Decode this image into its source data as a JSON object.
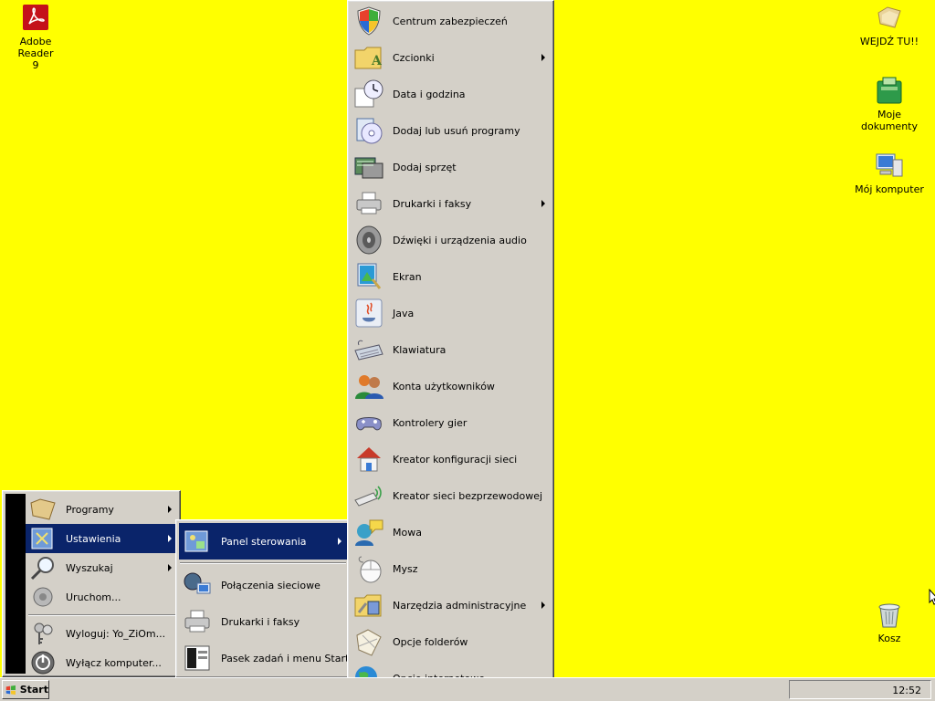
{
  "desktop": {
    "icons": [
      {
        "label": "Adobe Reader\n9",
        "icon": "adobe-reader-icon"
      },
      {
        "label": "WEJDŹ TU!!",
        "icon": "folder-icon"
      },
      {
        "label": "Moje\ndokumenty",
        "icon": "my-documents-icon"
      },
      {
        "label": "Mój komputer",
        "icon": "my-computer-icon"
      },
      {
        "label": "Kosz",
        "icon": "recycle-bin-icon"
      }
    ]
  },
  "start_menu": {
    "items": [
      {
        "label": "Programy",
        "icon": "programs-icon"
      },
      {
        "label": "Ustawienia",
        "icon": "settings-icon"
      },
      {
        "label": "Wyszukaj",
        "icon": "search-icon"
      },
      {
        "label": "Uruchom...",
        "icon": "run-icon"
      },
      {
        "label": "Wyloguj: Yo_ZiOm...",
        "icon": "logoff-icon"
      },
      {
        "label": "Wyłącz komputer...",
        "icon": "shutdown-icon"
      }
    ]
  },
  "settings_menu": {
    "items": [
      {
        "label": "Panel sterowania",
        "icon": "control-panel-icon"
      },
      {
        "label": "Połączenia sieciowe",
        "icon": "network-connections-icon"
      },
      {
        "label": "Drukarki i faksy",
        "icon": "printer-icon"
      },
      {
        "label": "Pasek zadań i menu Start",
        "icon": "taskbar-icon"
      }
    ]
  },
  "control_panel_menu": {
    "items": [
      {
        "label": "Centrum zabezpieczeń",
        "icon": "shield-icon"
      },
      {
        "label": "Czcionki",
        "icon": "fonts-folder-icon"
      },
      {
        "label": "Data i godzina",
        "icon": "clock-icon"
      },
      {
        "label": "Dodaj lub usuń programy",
        "icon": "add-remove-programs-icon"
      },
      {
        "label": "Dodaj sprzęt",
        "icon": "add-hardware-icon"
      },
      {
        "label": "Drukarki i faksy",
        "icon": "printer-icon"
      },
      {
        "label": "Dźwięki i urządzenia audio",
        "icon": "speaker-icon"
      },
      {
        "label": "Ekran",
        "icon": "display-icon"
      },
      {
        "label": "Java",
        "icon": "java-icon"
      },
      {
        "label": "Klawiatura",
        "icon": "keyboard-icon"
      },
      {
        "label": "Konta użytkowników",
        "icon": "user-accounts-icon"
      },
      {
        "label": "Kontrolery gier",
        "icon": "gamepad-icon"
      },
      {
        "label": "Kreator konfiguracji sieci",
        "icon": "network-setup-icon"
      },
      {
        "label": "Kreator sieci bezprzewodowej",
        "icon": "wireless-icon"
      },
      {
        "label": "Mowa",
        "icon": "speech-icon"
      },
      {
        "label": "Mysz",
        "icon": "mouse-icon"
      },
      {
        "label": "Narzędzia administracyjne",
        "icon": "admin-tools-icon"
      },
      {
        "label": "Opcje folderów",
        "icon": "folder-options-icon"
      },
      {
        "label": "Opcje internetowe",
        "icon": "internet-options-icon"
      }
    ]
  },
  "taskbar": {
    "start_label": "Start",
    "clock": "12:52"
  }
}
